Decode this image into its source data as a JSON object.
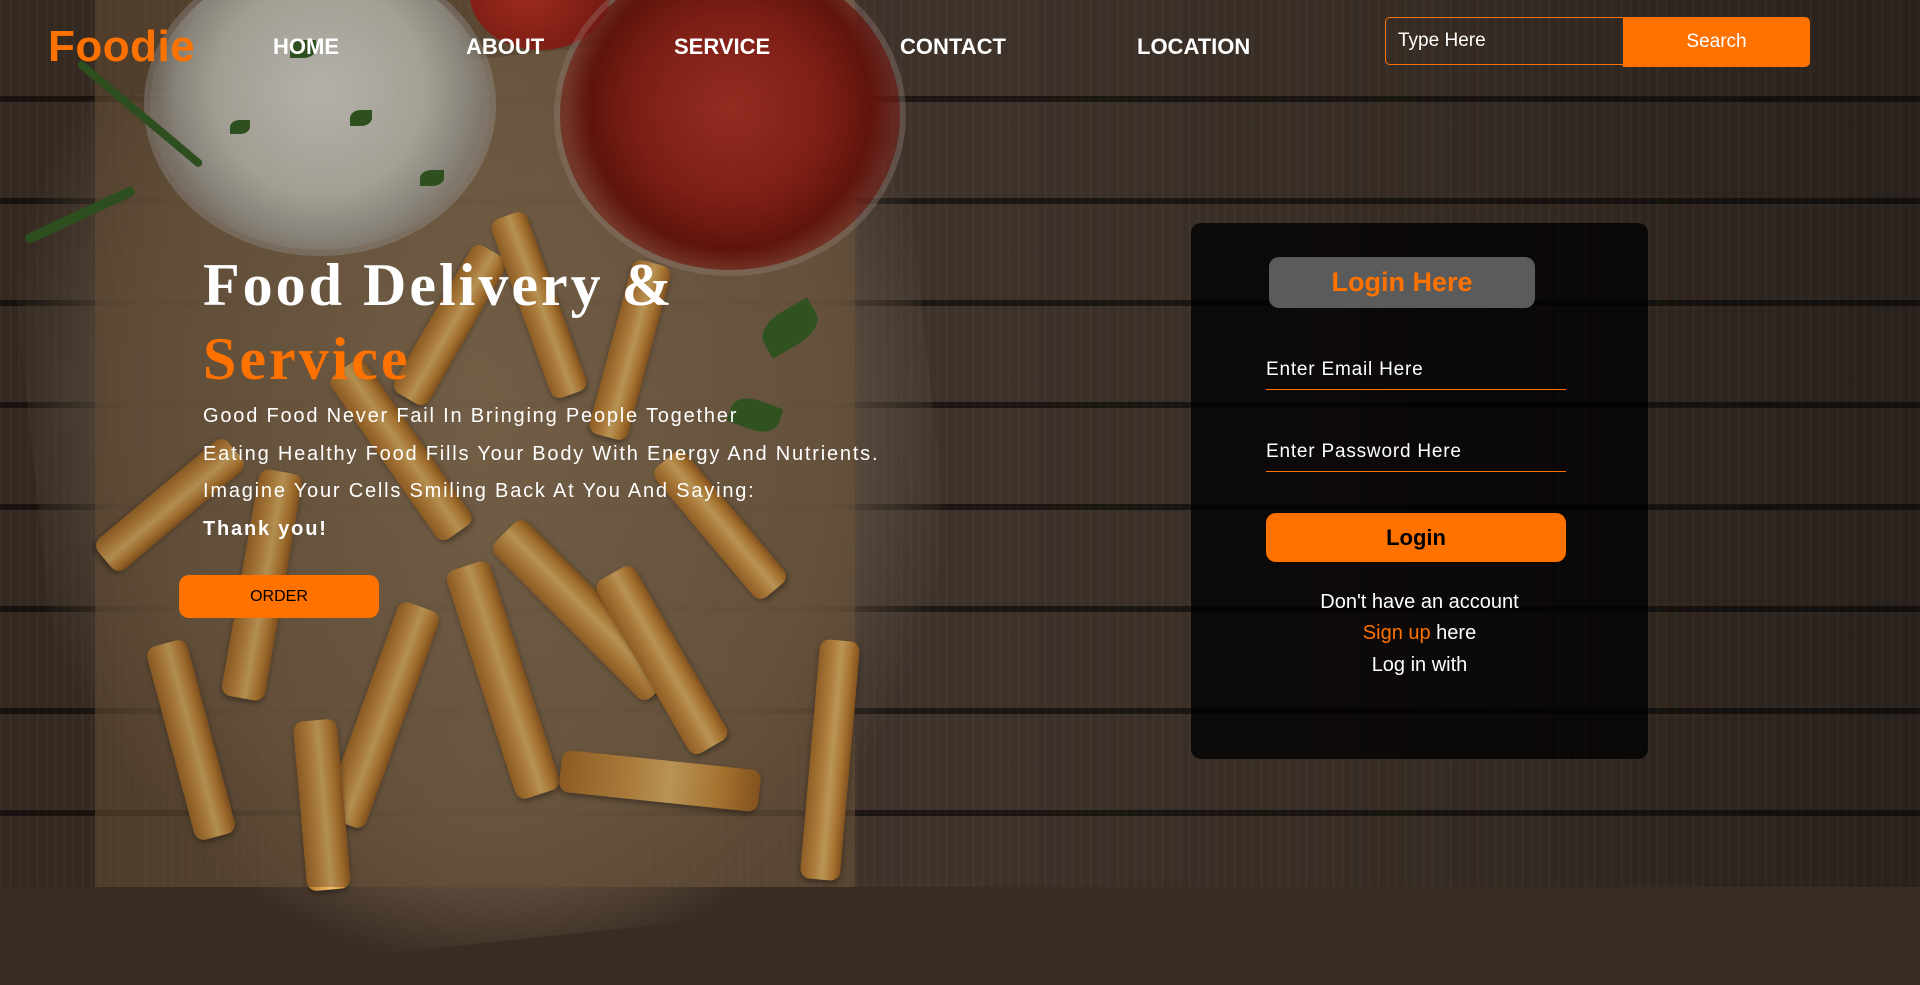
{
  "header": {
    "logo": "Foodie",
    "nav": [
      {
        "label": "HOME"
      },
      {
        "label": "ABOUT"
      },
      {
        "label": "SERVICE"
      },
      {
        "label": "CONTACT"
      },
      {
        "label": "LOCATION"
      }
    ],
    "search": {
      "placeholder": "Type Here",
      "button_label": "Search"
    }
  },
  "hero": {
    "title_line1": "Food Delivery &",
    "title_line2": "Service",
    "lines": [
      "Good Food Never Fail In Bringing People Together",
      "Eating Healthy Food Fills Your Body With Energy And Nutrients.",
      "Imagine Your Cells Smiling Back At You And Saying:",
      "Thank you!"
    ],
    "order_label": "ORDER"
  },
  "login": {
    "title": "Login Here",
    "email_placeholder": "Enter Email Here",
    "password_placeholder": "Enter Password Here",
    "button_label": "Login",
    "no_account_text": "Don't have an account",
    "signup_link": "Sign up",
    "signup_suffix": " here",
    "login_with_text": "Log in with"
  },
  "colors": {
    "accent": "#ff7200",
    "card_bg": "rgba(0,0,0,0.78)",
    "title_pill_bg": "#5b5b5b"
  }
}
